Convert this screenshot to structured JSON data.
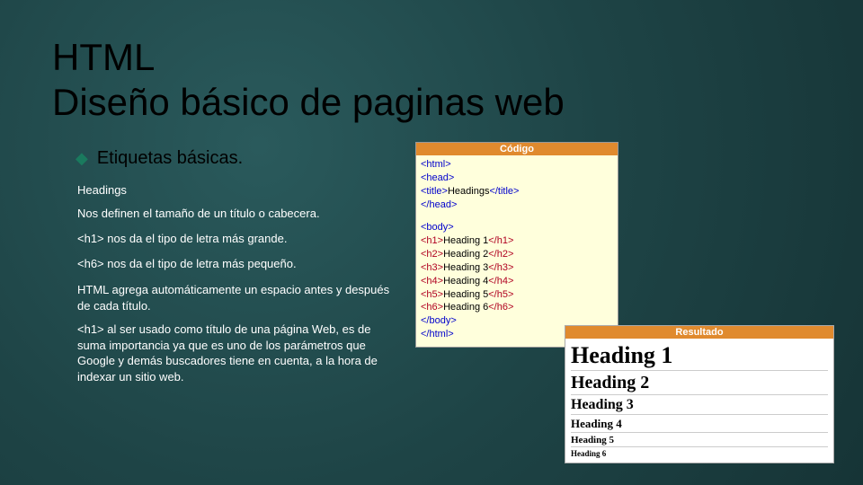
{
  "title": {
    "line1": "HTML",
    "line2": "Diseño básico de paginas web"
  },
  "bullet": {
    "label": "Etiquetas básicas."
  },
  "content": {
    "headings_label": "Headings",
    "p1": "Nos definen el tamaño de un título o cabecera.",
    "p2_tag": "<h1>",
    "p2_rest": " nos da el tipo de letra más grande.",
    "p3_tag": "<h6>",
    "p3_rest": " nos da el tipo de letra más pequeño.",
    "p4": "HTML agrega automáticamente un espacio antes y después de cada título.",
    "p5": "<h1> al ser usado como título de una página Web, es de suma importancia ya que es uno de los parámetros que Google y demás buscadores tiene en cuenta, a la hora de indexar un sitio web."
  },
  "code_panel": {
    "header": "Código",
    "lines": {
      "l1": "<html>",
      "l2": "<head>",
      "l3a": "<title>",
      "l3b": "Headings",
      "l3c": "</title>",
      "l4": "</head>",
      "l5": "<body>",
      "h1o": "<h1>",
      "h1t": "Heading 1",
      "h1c": "</h1>",
      "h2o": "<h2>",
      "h2t": "Heading 2",
      "h2c": "</h2>",
      "h3o": "<h3>",
      "h3t": "Heading 3",
      "h3c": "</h3>",
      "h4o": "<h4>",
      "h4t": "Heading 4",
      "h4c": "</h4>",
      "h5o": "<h5>",
      "h5t": "Heading 5",
      "h5c": "</h5>",
      "h6o": "<h6>",
      "h6t": "Heading 6",
      "h6c": "</h6>",
      "l12": "</body>",
      "l13": "</html>"
    }
  },
  "result_panel": {
    "header": "Resultado",
    "h1": "Heading 1",
    "h2": "Heading 2",
    "h3": "Heading 3",
    "h4": "Heading 4",
    "h5": "Heading 5",
    "h6": "Heading 6"
  }
}
